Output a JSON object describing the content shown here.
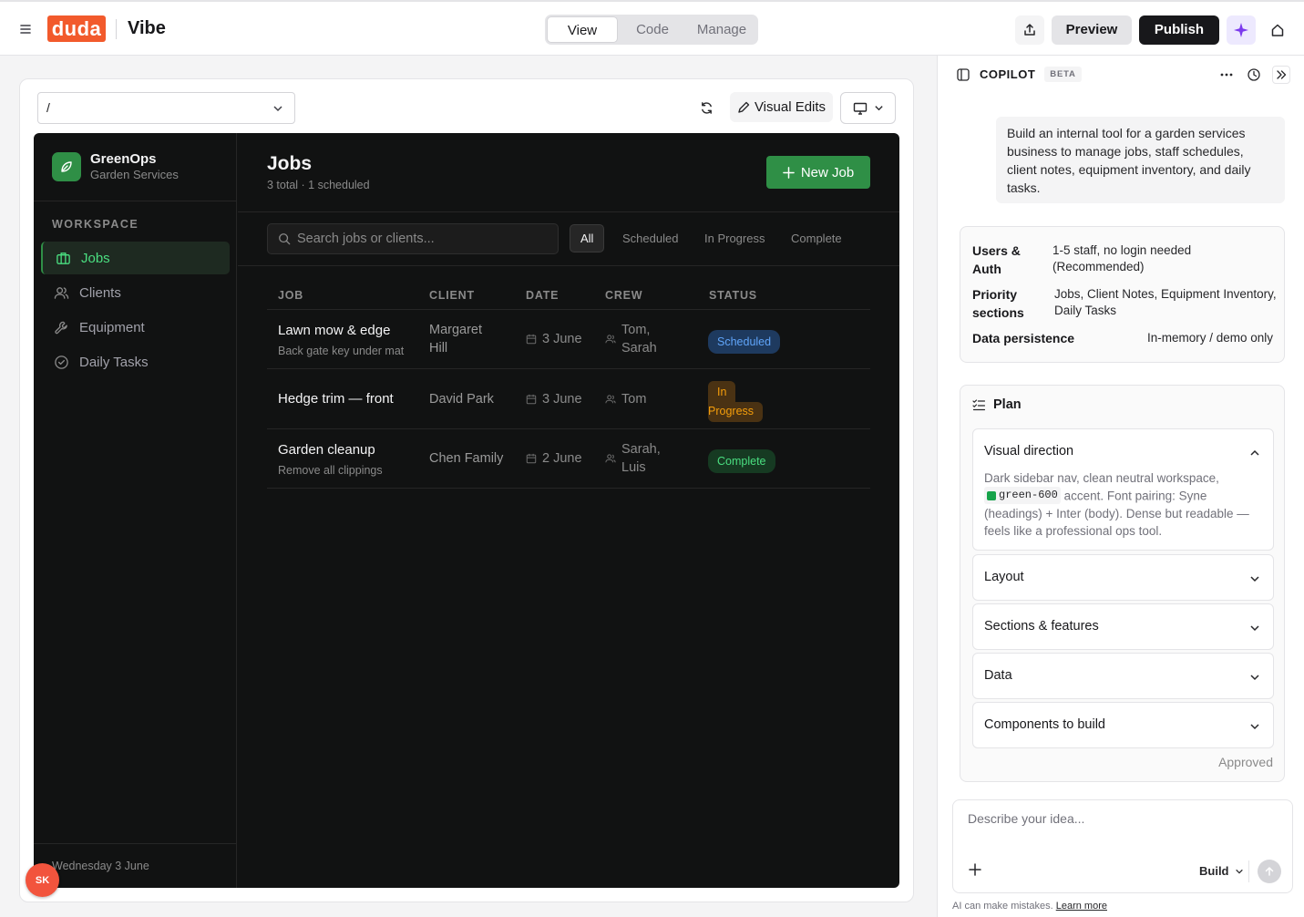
{
  "topbar": {
    "logo": "duda",
    "brand": "Vibe",
    "modes": [
      "View",
      "Code",
      "Manage"
    ],
    "active_mode": "View",
    "preview_label": "Preview",
    "publish_label": "Publish"
  },
  "canvas": {
    "path_value": "/",
    "visual_edits_label": "Visual Edits"
  },
  "app": {
    "name": "GreenOps",
    "subtitle": "Garden Services",
    "workspace_label": "WORKSPACE",
    "nav": [
      {
        "label": "Jobs",
        "icon": "briefcase-icon",
        "active": true
      },
      {
        "label": "Clients",
        "icon": "users-icon",
        "active": false
      },
      {
        "label": "Equipment",
        "icon": "wrench-icon",
        "active": false
      },
      {
        "label": "Daily Tasks",
        "icon": "check-circle-icon",
        "active": false
      }
    ],
    "footer_date": "Wednesday 3 June",
    "title": "Jobs",
    "summary": "3 total · 1 scheduled",
    "new_job_label": "New Job",
    "search_placeholder": "Search jobs or clients...",
    "filters": [
      "All",
      "Scheduled",
      "In Progress",
      "Complete"
    ],
    "active_filter": "All",
    "columns": [
      "JOB",
      "CLIENT",
      "DATE",
      "CREW",
      "STATUS"
    ],
    "rows": [
      {
        "job": "Lawn mow & edge",
        "note": "Back gate key under mat",
        "client_l1": "Margaret",
        "client_l2": "Hill",
        "date": "3 June",
        "crew_l1": "Tom,",
        "crew_l2": "Sarah",
        "status_l1": "Scheduled",
        "status_l2": ""
      },
      {
        "job": "Hedge trim — front",
        "note": "",
        "client_l1": "David Park",
        "client_l2": "",
        "date": "3 June",
        "crew_l1": "Tom",
        "crew_l2": "",
        "status_l1": "In",
        "status_l2": "Progress"
      },
      {
        "job": "Garden cleanup",
        "note": "Remove all clippings",
        "client_l1": "Chen Family",
        "client_l2": "",
        "date": "2 June",
        "crew_l1": "Sarah,",
        "crew_l2": "Luis",
        "status_l1": "Complete",
        "status_l2": ""
      }
    ],
    "accent": "#2f8f46"
  },
  "user_avatar": "SK",
  "copilot": {
    "title": "COPILOT",
    "beta": "BETA",
    "user_message": "Build an internal tool for a garden services business to manage jobs, staff schedules, client notes, equipment inventory, and daily tasks.",
    "answers": [
      {
        "key_l1": "Users &",
        "key_l2": "Auth",
        "value_l1": "1-5 staff, no login needed",
        "value_l2": "(Recommended)"
      },
      {
        "key_l1": "Priority",
        "key_l2": "sections",
        "value_l1": "Jobs, Client Notes, Equipment Inventory,",
        "value_l2": "Daily Tasks"
      },
      {
        "key_l1": "Data persistence",
        "key_l2": "",
        "value_l1": "In-memory / demo only",
        "value_l2": ""
      }
    ],
    "plan_title": "Plan",
    "visual_direction": {
      "title": "Visual direction",
      "text_before": "Dark sidebar nav, clean neutral workspace,",
      "code": "green-600",
      "text_after": "accent. Font pairing: Syne (headings) + Inter (body). Dense but readable — feels like a professional ops tool."
    },
    "sections": [
      "Layout",
      "Sections & features",
      "Data",
      "Components to build"
    ],
    "approved": "Approved",
    "input_placeholder": "Describe your idea...",
    "build_label": "Build",
    "disclaimer": "AI can make mistakes.",
    "learn_more": "Learn more"
  }
}
